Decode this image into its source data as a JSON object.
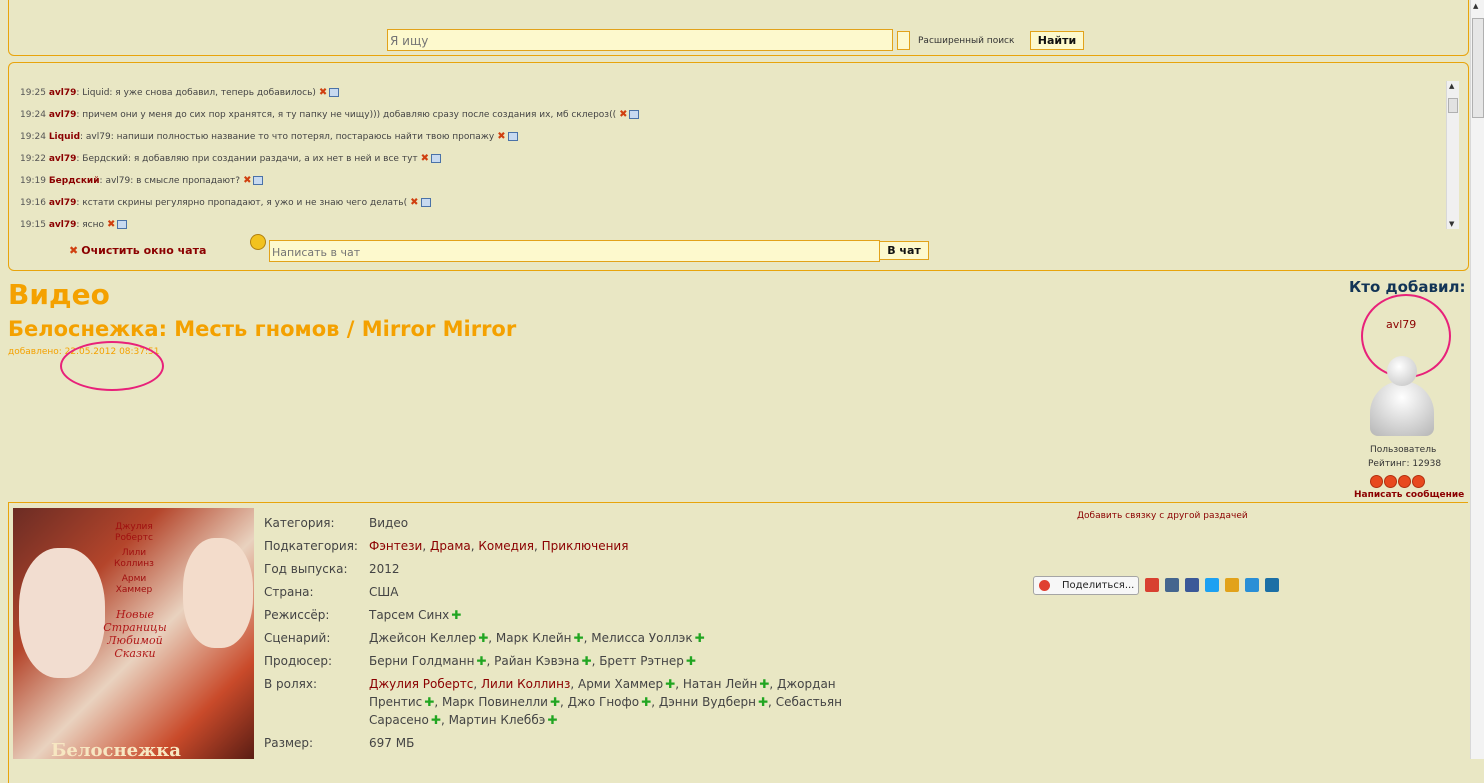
{
  "search": {
    "placeholder": "Я ищу",
    "advanced_label": "Расширенный поиск",
    "find_label": "Найти"
  },
  "chat": {
    "messages": [
      {
        "time": "19:25",
        "nick": "avl79",
        "text": ": Liquid: я уже снова добавил, теперь добавилось)"
      },
      {
        "time": "19:24",
        "nick": "avl79",
        "text": ": причем они у меня до сих пор хранятся, я ту папку не чищу))) добавляю сразу после создания их, мб склероз(("
      },
      {
        "time": "19:24",
        "nick": "Liquid",
        "text": ": avl79: напиши полностью название то что потерял, постараюсь найти твою пропажу"
      },
      {
        "time": "19:22",
        "nick": "avl79",
        "text": ": Бердский: я добавляю при создании раздачи, а их нет в ней и все тут"
      },
      {
        "time": "19:19",
        "nick": "Бердский",
        "text": ": avl79: в смысле пропадают?"
      },
      {
        "time": "19:16",
        "nick": "avl79",
        "text": ": кстати скрины регулярно пропадают, я ужо и не знаю чего делать("
      },
      {
        "time": "19:15",
        "nick": "avl79",
        "text": ": ясно"
      }
    ],
    "clear_label": "Очистить окно чата",
    "input_placeholder": "Написать в чат",
    "send_label": "В чат"
  },
  "release": {
    "category": "Видео",
    "title": "Белоснежка: Месть гномов / Mirror Mirror",
    "added_prefix": "добавлено: ",
    "added_date": "22.05.2012 08:37:51"
  },
  "uploader": {
    "heading": "Кто добавил:",
    "name": "avl79",
    "role": "Пользователь",
    "rating_label": "Рейтинг: ",
    "rating": "12938",
    "badge_count": 4,
    "send_message": "Написать сообщение"
  },
  "poster": {
    "actors": [
      "Джулия",
      "Робертс",
      "Лили",
      "Коллинз",
      "Арми",
      "Хаммер"
    ],
    "slogan": "Новые Страницы Любимой Сказки",
    "title": "Белоснежка"
  },
  "details": {
    "category": {
      "label": "Категория:",
      "value": "Видео"
    },
    "subcategory": {
      "label": "Подкатегория:",
      "values": [
        "Фэнтези",
        "Драма",
        "Комедия",
        "Приключения"
      ]
    },
    "year": {
      "label": "Год выпуска:",
      "value": "2012"
    },
    "country": {
      "label": "Страна:",
      "value": "США"
    },
    "director": {
      "label": "Режиссёр:",
      "people": [
        "Тарсем Синх"
      ]
    },
    "writers": {
      "label": "Сценарий:",
      "people": [
        "Джейсон Келлер",
        "Марк Клейн",
        "Мелисса Уоллэк"
      ]
    },
    "producers": {
      "label": "Продюсер:",
      "people": [
        "Берни Голдманн",
        "Райан Кэвэна",
        "Бретт Рэтнер"
      ]
    },
    "cast": {
      "label": "В ролях:",
      "linked": [
        "Джулия Робертс",
        "Лили Коллинз"
      ],
      "people": [
        "Арми Хаммер",
        "Натан Лейн",
        "Джордан Прентис",
        "Марк Повинелли",
        "Джо Гнофо",
        "Дэнни Вудберн",
        "Себастьян Сарасено",
        "Мартин Клеббэ"
      ]
    },
    "size": {
      "label": "Размер:",
      "value": "697 МБ"
    }
  },
  "actions": {
    "add_link": "Добавить связку с другой раздачей",
    "share_label": "Поделиться..."
  },
  "social_icons": [
    "info-icon",
    "vkontakte-icon",
    "facebook-icon",
    "twitter-icon",
    "odnoklassniki-icon",
    "moimir-icon",
    "livejournal-icon"
  ],
  "colors": {
    "accent": "#f4a100",
    "link": "#8b0000",
    "border": "#e8a40c",
    "background": "#e9e7c4",
    "annotation": "#e8217a",
    "plus": "#21a521"
  }
}
